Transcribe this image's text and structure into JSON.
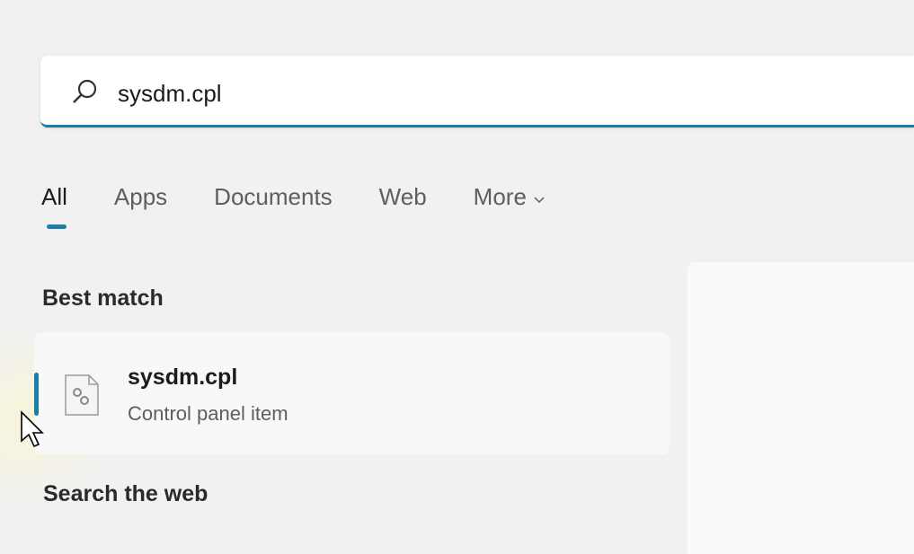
{
  "search": {
    "value": "sysdm.cpl",
    "icon": "search-icon"
  },
  "tabs": [
    {
      "label": "All"
    },
    {
      "label": "Apps"
    },
    {
      "label": "Documents"
    },
    {
      "label": "Web"
    },
    {
      "label": "More"
    }
  ],
  "best_match": {
    "heading": "Best match",
    "title": "sysdm.cpl",
    "subtitle": "Control panel item",
    "icon": "control-panel-file-icon"
  },
  "web": {
    "heading": "Search the web"
  },
  "accent": "#1a7ea6"
}
